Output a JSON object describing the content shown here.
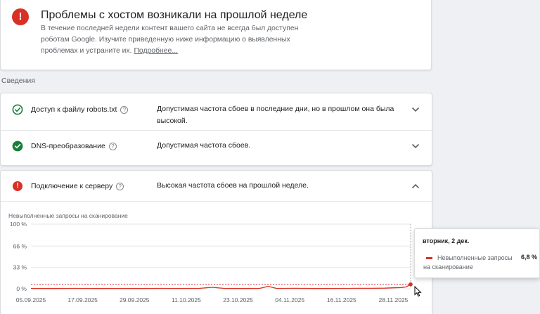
{
  "alert": {
    "title": "Проблемы с хостом возникали на прошлой неделе",
    "text": "В течение последней недели контент вашего сайта не всегда был доступен роботам Google. Изучите приведенную ниже информацию о выявленных проблемах и устраните их.",
    "link": "Подробнее...",
    "icon_text": "!"
  },
  "section_label": "Сведения",
  "rows": [
    {
      "name": "Доступ к файлу robots.txt",
      "description": "Допустимая частота сбоев в последние дни, но в прошлом она была высокой.",
      "status": "ok-outline",
      "help": "?"
    },
    {
      "name": "DNS-преобразование",
      "description": "Допустимая частота сбоев.",
      "status": "ok-filled",
      "help": "?"
    }
  ],
  "server": {
    "name": "Подключение к серверу",
    "description": "Высокая частота сбоев на прошлой неделе.",
    "help": "?",
    "icon_text": "!"
  },
  "colors": {
    "error": "#d93025",
    "ok": "#188038",
    "grid": "#e6e6e6"
  },
  "chart_data": {
    "type": "line",
    "title": "Невыполненные запросы на сканирование",
    "y_ticks": [
      "100 %",
      "66 %",
      "33 %",
      "0 %"
    ],
    "y_tick_values": [
      100,
      66,
      33,
      0
    ],
    "ylim": [
      0,
      100
    ],
    "x_ticks": [
      "05.09.2025",
      "17.09.2025",
      "29.09.2025",
      "11.10.2025",
      "23.10.2025",
      "04.11.2025",
      "16.11.2025",
      "28.11.2025"
    ],
    "x_range": [
      "05.09.2025",
      "02.12.2025"
    ],
    "grid": true,
    "series": [
      {
        "name": "Невыполненные запросы на сканирование",
        "x": [
          "05.09.2025",
          "10.09.2025",
          "15.09.2025",
          "20.09.2025",
          "25.09.2025",
          "30.09.2025",
          "05.10.2025",
          "10.10.2025",
          "14.10.2025",
          "17.10.2025",
          "20.10.2025",
          "25.10.2025",
          "28.10.2025",
          "30.10.2025",
          "01.11.2025",
          "05.11.2025",
          "10.11.2025",
          "15.11.2025",
          "18.11.2025",
          "20.11.2025",
          "23.11.2025",
          "26.11.2025",
          "28.11.2025",
          "30.11.2025",
          "01.12.2025",
          "02.12.2025"
        ],
        "values": [
          0.4,
          0.3,
          0.5,
          0.3,
          0.4,
          0.3,
          0.5,
          0.4,
          0.5,
          2.2,
          0.4,
          0.3,
          0.5,
          3.6,
          0.4,
          0.6,
          0.3,
          0.4,
          0.5,
          0.6,
          0.7,
          0.9,
          1.4,
          1.9,
          2.8,
          6.8
        ]
      }
    ],
    "reference_line": 6.8,
    "tooltip": {
      "date": "вторник, 2 дек.",
      "series": "Невыполненные запросы на сканирование",
      "value": "6,8 %"
    }
  }
}
